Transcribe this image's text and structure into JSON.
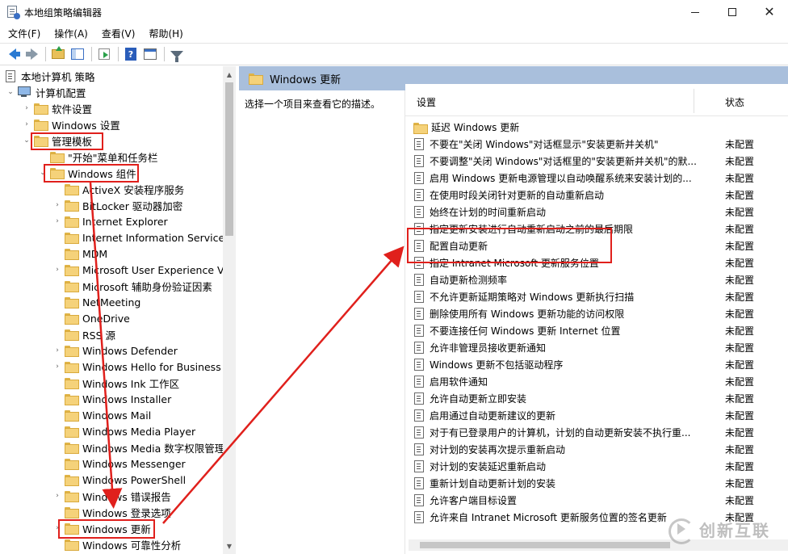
{
  "window": {
    "title": "本地组策略编辑器",
    "min": "—",
    "max": "□",
    "close": "✕"
  },
  "menu": [
    "文件(F)",
    "操作(A)",
    "查看(V)",
    "帮助(H)"
  ],
  "toolbar": {
    "help_glyph": "?"
  },
  "tree": {
    "items": [
      {
        "label": "本地计算机 策略",
        "icon": "policy-icon"
      },
      {
        "label": "计算机配置",
        "icon": "computer-icon"
      },
      {
        "label": "软件设置",
        "icon": "folder-icon"
      },
      {
        "label": "Windows 设置",
        "icon": "folder-icon"
      },
      {
        "label": "管理模板",
        "icon": "folder-icon"
      },
      {
        "label": "\"开始\"菜单和任务栏",
        "icon": "folder-icon"
      },
      {
        "label": "Windows 组件",
        "icon": "folder-icon"
      },
      {
        "label": "ActiveX 安装程序服务",
        "icon": "folder-icon"
      },
      {
        "label": "BitLocker 驱动器加密",
        "icon": "folder-icon"
      },
      {
        "label": "Internet Explorer",
        "icon": "folder-icon"
      },
      {
        "label": "Internet Information Services",
        "icon": "folder-icon"
      },
      {
        "label": "MDM",
        "icon": "folder-icon"
      },
      {
        "label": "Microsoft User Experience Vir",
        "icon": "folder-icon"
      },
      {
        "label": "Microsoft 辅助身份验证因素",
        "icon": "folder-icon"
      },
      {
        "label": "NetMeeting",
        "icon": "folder-icon"
      },
      {
        "label": "OneDrive",
        "icon": "folder-icon"
      },
      {
        "label": "RSS 源",
        "icon": "folder-icon"
      },
      {
        "label": "Windows Defender",
        "icon": "folder-icon"
      },
      {
        "label": "Windows Hello for Business",
        "icon": "folder-icon"
      },
      {
        "label": "Windows Ink 工作区",
        "icon": "folder-icon"
      },
      {
        "label": "Windows Installer",
        "icon": "folder-icon"
      },
      {
        "label": "Windows Mail",
        "icon": "folder-icon"
      },
      {
        "label": "Windows Media Player",
        "icon": "folder-icon"
      },
      {
        "label": "Windows Media 数字权限管理",
        "icon": "folder-icon"
      },
      {
        "label": "Windows Messenger",
        "icon": "folder-icon"
      },
      {
        "label": "Windows PowerShell",
        "icon": "folder-icon"
      },
      {
        "label": "Windows 错误报告",
        "icon": "folder-icon"
      },
      {
        "label": "Windows 登录选项",
        "icon": "folder-icon"
      },
      {
        "label": "Windows 更新",
        "icon": "folder-icon"
      },
      {
        "label": "Windows 可靠性分析",
        "icon": "folder-icon"
      }
    ]
  },
  "right": {
    "header": "Windows 更新",
    "description": "选择一个项目来查看它的描述。",
    "col_setting": "设置",
    "col_state": "状态",
    "rows": [
      {
        "name": "延迟 Windows 更新",
        "state": "",
        "folder": true
      },
      {
        "name": "不要在\"关闭 Windows\"对话框显示\"安装更新并关机\"",
        "state": "未配置"
      },
      {
        "name": "不要调整\"关闭 Windows\"对话框里的\"安装更新并关机\"的默...",
        "state": "未配置"
      },
      {
        "name": "启用 Windows 更新电源管理以自动唤醒系统来安装计划的...",
        "state": "未配置"
      },
      {
        "name": "在使用时段关闭针对更新的自动重新启动",
        "state": "未配置"
      },
      {
        "name": "始终在计划的时间重新启动",
        "state": "未配置"
      },
      {
        "name": "指定更新安装进行自动重新启动之前的最后期限",
        "state": "未配置"
      },
      {
        "name": "配置自动更新",
        "state": "未配置"
      },
      {
        "name": "指定 Intranet Microsoft 更新服务位置",
        "state": "未配置"
      },
      {
        "name": "自动更新检测频率",
        "state": "未配置"
      },
      {
        "name": "不允许更新延期策略对 Windows 更新执行扫描",
        "state": "未配置"
      },
      {
        "name": "删除使用所有 Windows 更新功能的访问权限",
        "state": "未配置"
      },
      {
        "name": "不要连接任何 Windows 更新 Internet 位置",
        "state": "未配置"
      },
      {
        "name": "允许非管理员接收更新通知",
        "state": "未配置"
      },
      {
        "name": "Windows 更新不包括驱动程序",
        "state": "未配置"
      },
      {
        "name": "启用软件通知",
        "state": "未配置"
      },
      {
        "name": "允许自动更新立即安装",
        "state": "未配置"
      },
      {
        "name": "启用通过自动更新建议的更新",
        "state": "未配置"
      },
      {
        "name": "对于有已登录用户的计算机，计划的自动更新安装不执行重...",
        "state": "未配置"
      },
      {
        "name": "对计划的安装再次提示重新启动",
        "state": "未配置"
      },
      {
        "name": "对计划的安装延迟重新启动",
        "state": "未配置"
      },
      {
        "name": "重新计划自动更新计划的安装",
        "state": "未配置"
      },
      {
        "name": "允许客户端目标设置",
        "state": "未配置"
      },
      {
        "name": "允许来自 Intranet Microsoft 更新服务位置的签名更新",
        "state": "未配置"
      }
    ]
  },
  "watermark": {
    "text": "创新互联"
  },
  "colors": {
    "annotation": "#e0201c",
    "header_bg": "#a9bfdc"
  }
}
